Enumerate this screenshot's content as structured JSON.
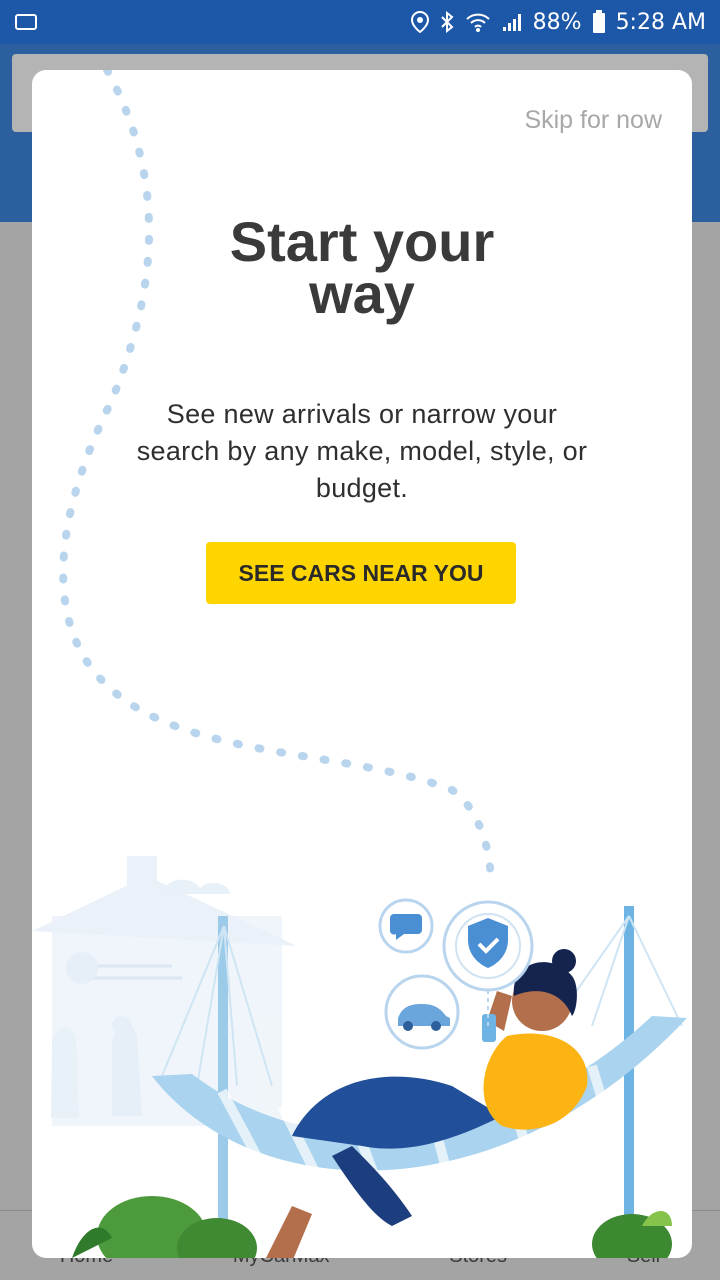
{
  "status_bar": {
    "battery": "88%",
    "time": "5:28 AM",
    "icons": [
      "location-icon",
      "bluetooth-icon",
      "wifi-icon",
      "signal-icon",
      "battery-icon"
    ]
  },
  "background_app": {
    "bottom_nav": [
      "Home",
      "MyCarMax",
      "Stores",
      "Sell"
    ]
  },
  "onboarding": {
    "skip_label": "Skip for now",
    "title_line1": "Start your",
    "title_line2": "way",
    "description": "See new arrivals or narrow your search by any make, model, style, or budget.",
    "cta_label": "SEE CARS NEAR YOU",
    "colors": {
      "cta": "#ffd500",
      "accent_blue": "#1d57a8",
      "hammock_blue": "#9fcdea"
    }
  }
}
